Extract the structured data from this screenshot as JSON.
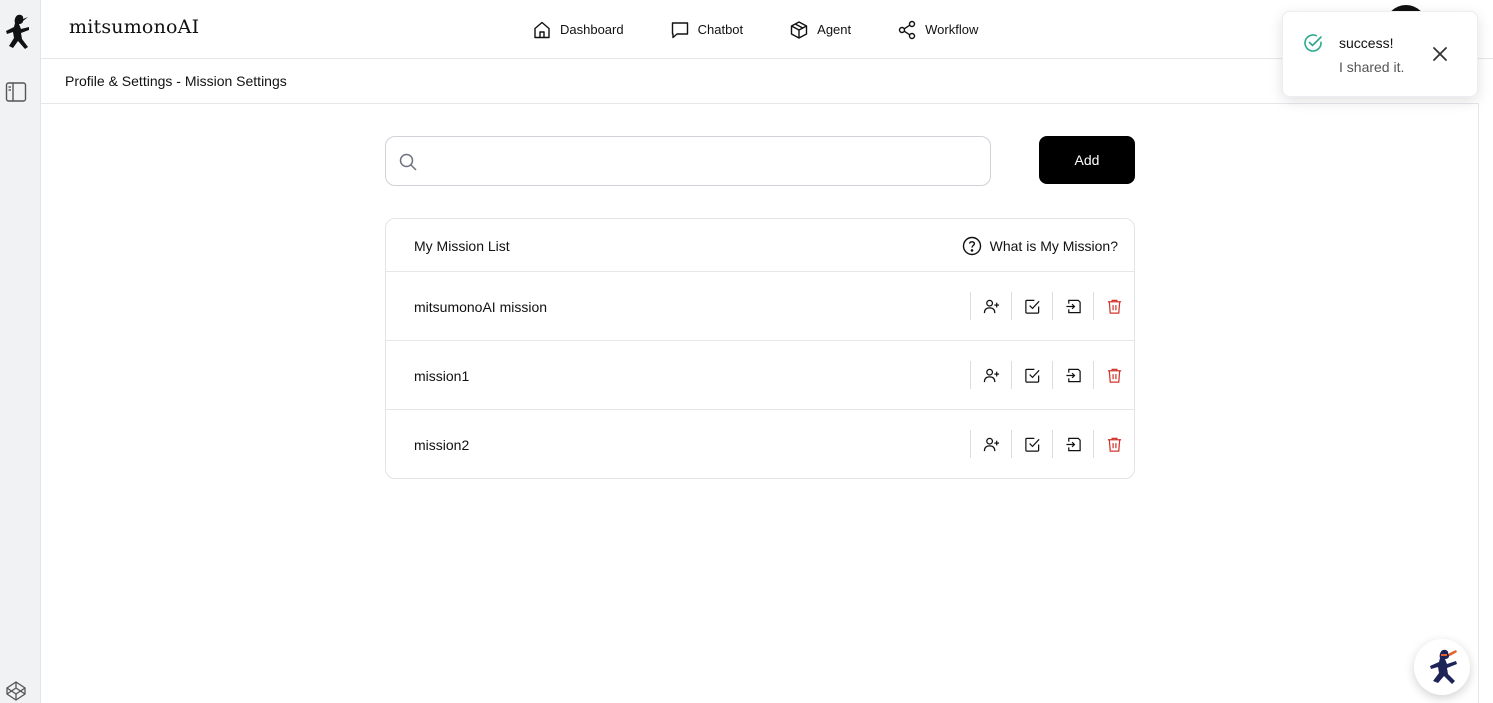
{
  "app": {
    "brand": "mitsumonoAI"
  },
  "nav": [
    {
      "label": "Dashboard",
      "icon": "home-icon"
    },
    {
      "label": "Chatbot",
      "icon": "chat-icon"
    },
    {
      "label": "Agent",
      "icon": "box-icon"
    },
    {
      "label": "Workflow",
      "icon": "share-icon"
    }
  ],
  "breadcrumb": "Profile & Settings - Mission Settings",
  "search": {
    "placeholder": "",
    "value": ""
  },
  "add_label": "Add",
  "mission_list": {
    "title": "My Mission List",
    "help_label": "What is My Mission?",
    "items": [
      {
        "name": "mitsumonoAI mission"
      },
      {
        "name": "mission1"
      },
      {
        "name": "mission2"
      }
    ],
    "actions": [
      "add-member-icon",
      "check-square-icon",
      "login-icon",
      "trash-icon"
    ]
  },
  "toast": {
    "title": "success!",
    "message": "I shared it.",
    "status_color": "#2aa98c"
  },
  "colors": {
    "accent": "#000000",
    "danger": "#d0342c",
    "navy": "#1d2457",
    "orange": "#e8612a"
  }
}
